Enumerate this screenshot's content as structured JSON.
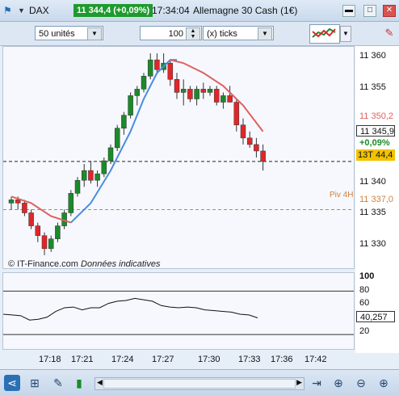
{
  "titlebar": {
    "symbol": "DAX",
    "price_badge": "11 344,4 (+0,09%)",
    "time": "17:34:04",
    "instrument": "Allemagne 30 Cash (1€)"
  },
  "toolbar": {
    "units_value": "50 unités",
    "ticks_value": "100",
    "ticks_unit": "(x) ticks"
  },
  "main_chart": {
    "copyright": "© IT-Finance.com",
    "disclaimer": "Données indicatives",
    "pivot_label": "Piv 4H",
    "y_ticks": [
      "11 360",
      "11 355",
      "11 350,2",
      "11 345,9",
      "+0,09%",
      "13T",
      "44,4",
      "11 340",
      "11 337,0",
      "11 335",
      "11 330"
    ],
    "colors": {
      "up": "#1b8a2a",
      "down": "#e0262a",
      "ma_fast": "#4a8ce0",
      "ma_slow": "#e06060",
      "pivot": "#d08040"
    }
  },
  "sub_chart": {
    "y_ticks": [
      "100",
      "80",
      "60",
      "40,257",
      "20"
    ]
  },
  "x_ticks": [
    "17:18",
    "17:21",
    "17:24",
    "17:27",
    "17:30",
    "17:33",
    "17:36",
    "17:42"
  ],
  "chart_data": {
    "type": "candlestick",
    "ylim": [
      11328,
      11362
    ],
    "candles": [
      [
        11338,
        11339,
        11337,
        11338.5
      ],
      [
        11338.5,
        11339,
        11337,
        11338
      ],
      [
        11338,
        11338.5,
        11336,
        11336.5
      ],
      [
        11336.5,
        11337,
        11334,
        11334.5
      ],
      [
        11334.5,
        11335,
        11332,
        11333
      ],
      [
        11333,
        11333.5,
        11330,
        11331
      ],
      [
        11331,
        11333,
        11330.5,
        11332.5
      ],
      [
        11332.5,
        11335,
        11332,
        11334.5
      ],
      [
        11334.5,
        11337,
        11334,
        11336.5
      ],
      [
        11336.5,
        11340,
        11336,
        11339.5
      ],
      [
        11339.5,
        11342,
        11339,
        11341.5
      ],
      [
        11341.5,
        11344,
        11340.5,
        11343
      ],
      [
        11343,
        11344.5,
        11341,
        11341.5
      ],
      [
        11341.5,
        11343,
        11340.5,
        11342.5
      ],
      [
        11342.5,
        11345,
        11342,
        11344.5
      ],
      [
        11344.5,
        11347,
        11344,
        11346.5
      ],
      [
        11346.5,
        11350,
        11346,
        11349.5
      ],
      [
        11349.5,
        11352,
        11348.5,
        11351.5
      ],
      [
        11351.5,
        11355,
        11351,
        11354.5
      ],
      [
        11354.5,
        11356,
        11353,
        11355.5
      ],
      [
        11355.5,
        11358,
        11355,
        11357.5
      ],
      [
        11357.5,
        11361,
        11357,
        11360
      ],
      [
        11360,
        11361,
        11358,
        11358.5
      ],
      [
        11358.5,
        11361,
        11358,
        11359.5
      ],
      [
        11359.5,
        11360,
        11356,
        11357
      ],
      [
        11357,
        11358,
        11354,
        11355
      ],
      [
        11355,
        11357,
        11353,
        11355.5
      ],
      [
        11355.5,
        11356,
        11353.5,
        11354
      ],
      [
        11354,
        11356,
        11353,
        11355.5
      ],
      [
        11355.5,
        11356.5,
        11354,
        11355
      ],
      [
        11355,
        11356,
        11354.5,
        11355.5
      ],
      [
        11355.5,
        11356,
        11353,
        11353.5
      ],
      [
        11353.5,
        11355,
        11352.5,
        11354.5
      ],
      [
        11354.5,
        11356,
        11353.5,
        11353.5
      ],
      [
        11353.5,
        11354,
        11349,
        11350
      ],
      [
        11350,
        11351,
        11347,
        11348
      ],
      [
        11348,
        11349,
        11346.5,
        11347
      ],
      [
        11347,
        11348,
        11345,
        11346
      ],
      [
        11346,
        11347,
        11343,
        11344.4
      ]
    ],
    "ma_fast_points": [
      [
        9,
        11335
      ],
      [
        12,
        11338
      ],
      [
        15,
        11343
      ],
      [
        18,
        11349
      ],
      [
        20,
        11354
      ],
      [
        22,
        11358
      ],
      [
        24,
        11360
      ],
      [
        25,
        11360
      ]
    ],
    "ma_slow_points": [
      [
        0,
        11339
      ],
      [
        3,
        11338
      ],
      [
        6,
        11336
      ],
      [
        9,
        11335
      ]
    ],
    "ma_slow2_points": [
      [
        24,
        11360
      ],
      [
        26,
        11359.5
      ],
      [
        29,
        11358
      ],
      [
        32,
        11356
      ],
      [
        35,
        11353
      ],
      [
        38,
        11349
      ]
    ],
    "pivot": 11337.0,
    "last_close": 11344.4,
    "oscillator": {
      "ylim": [
        0,
        105
      ],
      "levels": [
        80,
        20
      ],
      "last": 40.257,
      "values": [
        48,
        47,
        46,
        40,
        41,
        44,
        52,
        57,
        58,
        54,
        57,
        57,
        63,
        66,
        67,
        70,
        68,
        66,
        60,
        58,
        57,
        58,
        57,
        54,
        53,
        52,
        51,
        48,
        47,
        43
      ]
    }
  }
}
